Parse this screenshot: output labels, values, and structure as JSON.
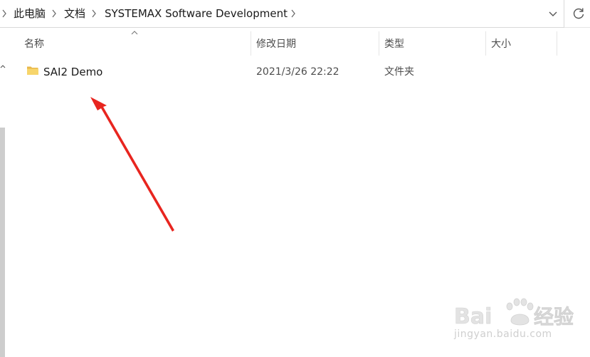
{
  "breadcrumb": {
    "items": [
      "此电脑",
      "文档",
      "SYSTEMAX Software Development"
    ]
  },
  "columns": {
    "name": "名称",
    "modified": "修改日期",
    "type": "类型",
    "size": "大小"
  },
  "rows": [
    {
      "name": "SAI2 Demo",
      "modified": "2021/3/26 22:22",
      "type": "文件夹",
      "size": ""
    }
  ],
  "icons": {
    "folder": "folder-icon",
    "dropdown": "chevron-down-icon",
    "refresh": "refresh-icon",
    "separator": "chevron-right-icon",
    "sort": "sort-ascending-icon"
  },
  "annotation": {
    "arrow_color": "#e8251f"
  },
  "watermark": {
    "logo_text": "Baidu经验",
    "url": "jingyan.baidu.com"
  }
}
